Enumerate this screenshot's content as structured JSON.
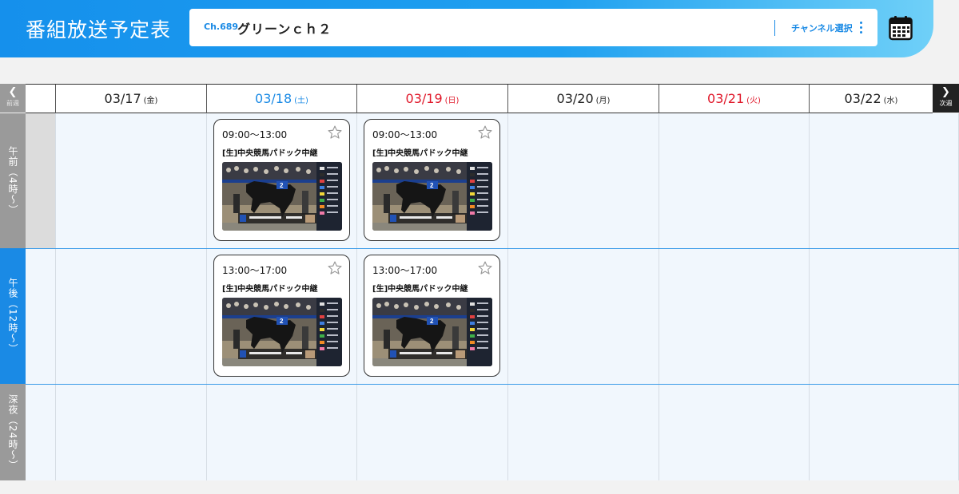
{
  "header": {
    "title": "番組放送予定表",
    "channel_number": "Ch.689",
    "channel_name": "グリーンｃｈ２",
    "channel_select_label": "チャンネル選択"
  },
  "nav": {
    "prev_label": "前週",
    "next_label": "次週"
  },
  "days": [
    {
      "date": "03/17",
      "weekday": "(金)",
      "type": "weekday"
    },
    {
      "date": "03/18",
      "weekday": "(土)",
      "type": "saturday"
    },
    {
      "date": "03/19",
      "weekday": "(日)",
      "type": "holiday"
    },
    {
      "date": "03/20",
      "weekday": "(月)",
      "type": "weekday"
    },
    {
      "date": "03/21",
      "weekday": "(火)",
      "type": "holiday"
    },
    {
      "date": "03/22",
      "weekday": "(水)",
      "type": "weekday"
    }
  ],
  "slots": [
    {
      "label": "午前（4時〜）",
      "color": "#9a9a9a"
    },
    {
      "label": "午後（12時〜）",
      "color": "#1a8ae5"
    },
    {
      "label": "深夜（24時〜）",
      "color": "#9a9a9a"
    }
  ],
  "programs": [
    {
      "day": 1,
      "slot": 0,
      "time": "09:00〜13:00",
      "title": "[生]中央競馬パドック中継"
    },
    {
      "day": 2,
      "slot": 0,
      "time": "09:00〜13:00",
      "title": "[生]中央競馬パドック中継"
    },
    {
      "day": 1,
      "slot": 1,
      "time": "13:00〜17:00",
      "title": "[生]中央競馬パドック中継"
    },
    {
      "day": 2,
      "slot": 1,
      "time": "13:00〜17:00",
      "title": "[生]中央競馬パドック中継"
    }
  ],
  "colors": {
    "accent": "#1a8ae5",
    "holiday": "#e0182a",
    "cell_bg": "#f1f7fd"
  }
}
